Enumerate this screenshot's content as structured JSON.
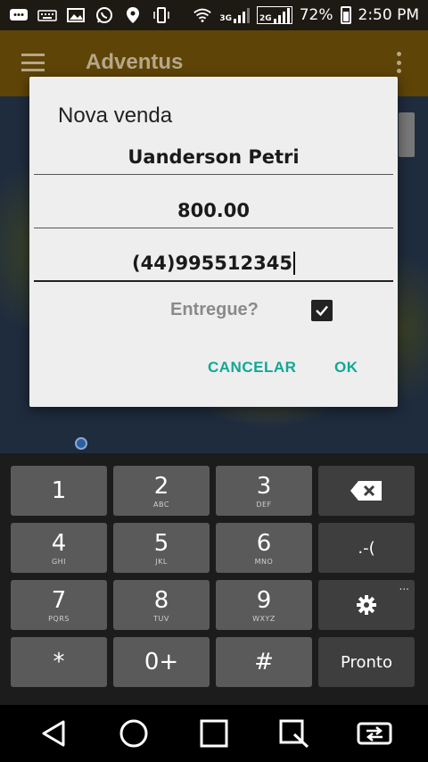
{
  "status_bar": {
    "battery": "72%",
    "time": "2:50 PM",
    "network_1": "3G",
    "network_2": "2G"
  },
  "app_bar": {
    "title": "Adventus"
  },
  "dialog": {
    "title": "Nova venda",
    "name_value": "Uanderson Petri",
    "amount_value": "800.00",
    "phone_value": "(44)995512345",
    "delivered_label": "Entregue?",
    "delivered_checked": true,
    "cancel_label": "CANCELAR",
    "ok_label": "OK"
  },
  "keyboard": {
    "keys": [
      {
        "main": "1",
        "sub": ""
      },
      {
        "main": "2",
        "sub": "ABC"
      },
      {
        "main": "3",
        "sub": "DEF"
      },
      {
        "main": "4",
        "sub": "GHI"
      },
      {
        "main": "5",
        "sub": "JKL"
      },
      {
        "main": "6",
        "sub": "MNO"
      },
      {
        "main": "7",
        "sub": "PQRS"
      },
      {
        "main": "8",
        "sub": "TUV"
      },
      {
        "main": "9",
        "sub": "WXYZ"
      },
      {
        "main": "*",
        "sub": ""
      },
      {
        "main": "0+",
        "sub": ""
      },
      {
        "main": "#",
        "sub": ""
      }
    ],
    "punct_label": ".-(",
    "done_label": "Pronto",
    "more_indicator": "..."
  },
  "colors": {
    "accent": "#10a894",
    "app_bar": "#7b5a0b"
  }
}
